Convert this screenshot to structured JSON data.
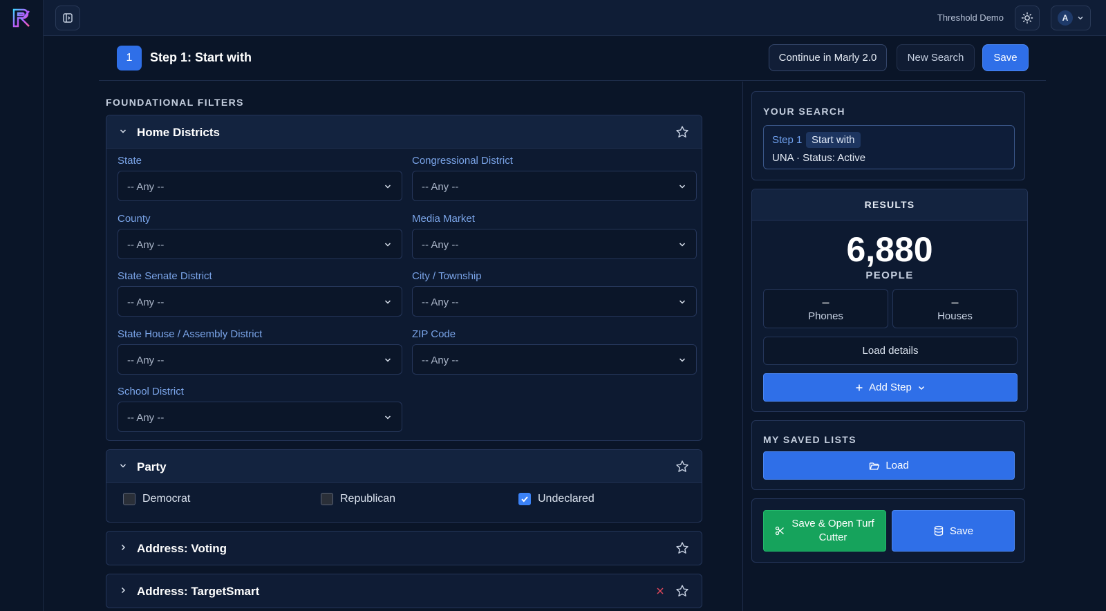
{
  "topbar": {
    "org_name": "Threshold Demo",
    "user_initial": "A"
  },
  "step": {
    "number": "1",
    "title": "Step 1: Start with",
    "continue_label": "Continue in Marly 2.0",
    "new_search_label": "New Search",
    "save_label": "Save"
  },
  "filters": {
    "section_label": "FOUNDATIONAL FILTERS",
    "home_districts": {
      "title": "Home Districts",
      "fields": [
        {
          "label": "State",
          "value": "-- Any --"
        },
        {
          "label": "Congressional District",
          "value": "-- Any --"
        },
        {
          "label": "County",
          "value": "-- Any --"
        },
        {
          "label": "Media Market",
          "value": "-- Any --"
        },
        {
          "label": "State Senate District",
          "value": "-- Any --"
        },
        {
          "label": "City / Township",
          "value": "-- Any --"
        },
        {
          "label": "State House / Assembly District",
          "value": "-- Any --"
        },
        {
          "label": "ZIP Code",
          "value": "-- Any --"
        },
        {
          "label": "School District",
          "value": "-- Any --"
        }
      ]
    },
    "party": {
      "title": "Party",
      "options": [
        {
          "label": "Democrat",
          "checked": false
        },
        {
          "label": "Republican",
          "checked": false
        },
        {
          "label": "Undeclared",
          "checked": true
        }
      ]
    },
    "address_voting": {
      "title": "Address: Voting"
    },
    "address_targetsmart": {
      "title": "Address: TargetSmart"
    }
  },
  "your_search": {
    "label": "YOUR SEARCH",
    "step_tag": "Step 1",
    "start_tag": "Start with",
    "description": "UNA · Status: Active"
  },
  "results": {
    "label": "RESULTS",
    "count": "6,880",
    "unit": "PEOPLE",
    "phones_value": "–",
    "phones_label": "Phones",
    "houses_value": "–",
    "houses_label": "Houses",
    "load_details": "Load details",
    "add_step": "Add Step"
  },
  "saved_lists": {
    "label": "MY SAVED LISTS",
    "load": "Load"
  },
  "actions": {
    "turf_label": "Save & Open Turf Cutter",
    "save_label": "Save"
  },
  "colors": {
    "primary": "#2f6fe8",
    "success": "#16a35c",
    "background": "#0a1528"
  }
}
